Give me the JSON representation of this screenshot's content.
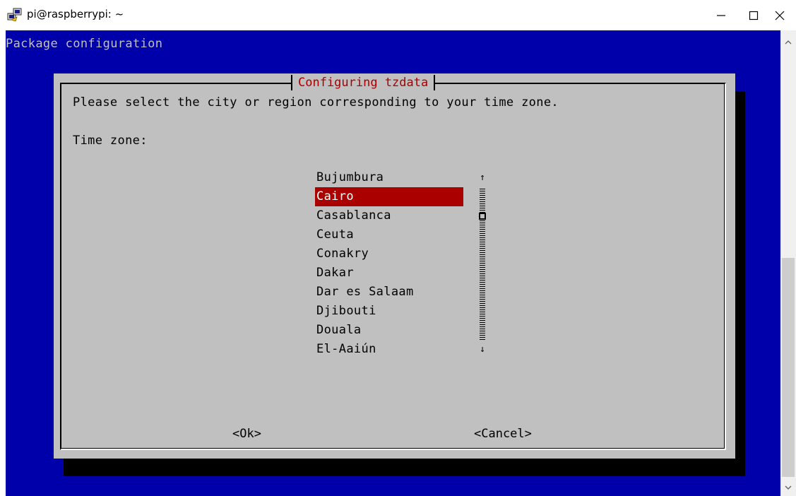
{
  "window": {
    "title": "pi@raspberrypi: ~",
    "controls": {
      "minimize": "—",
      "maximize": "☐",
      "close": "✕"
    }
  },
  "terminal": {
    "header": "Package configuration",
    "background": "#0000aa"
  },
  "dialog": {
    "title": "Configuring tzdata",
    "prompt": "Please select the city or region corresponding to your time zone.",
    "label": "Time zone:",
    "options": [
      "Bujumbura",
      "Cairo",
      "Casablanca",
      "Ceuta",
      "Conakry",
      "Dakar",
      "Dar es Salaam",
      "Djibouti",
      "Douala",
      "El-Aaiún"
    ],
    "selected": "Cairo",
    "scroll_up": "↑",
    "scroll_down": "↓",
    "ok_label": "<Ok>",
    "cancel_label": "<Cancel>"
  },
  "colors": {
    "selection": "#aa0000",
    "dialog_bg": "#c0c0c0",
    "title_text": "#aa0000"
  },
  "icons": {
    "app": "putty-icon",
    "minimize": "minimize-icon",
    "maximize": "maximize-icon",
    "close": "close-icon"
  }
}
